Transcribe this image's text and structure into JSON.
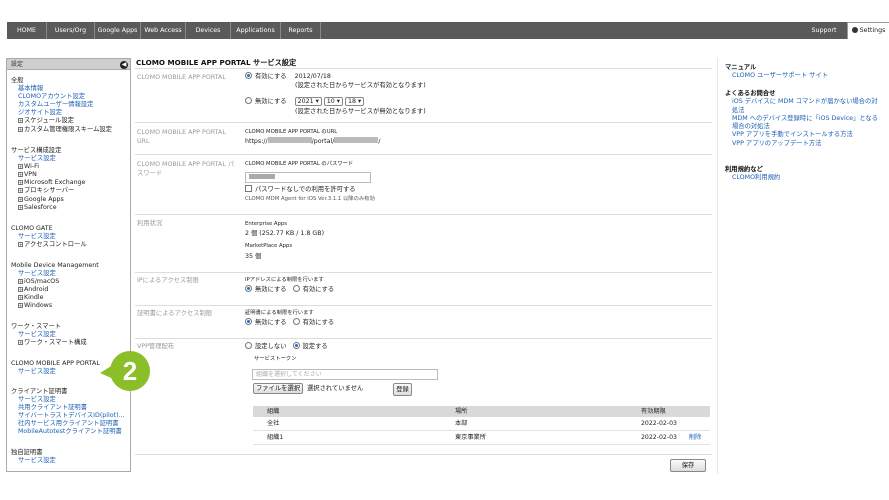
{
  "topnav": {
    "items": [
      "HOME",
      "Users/Org",
      "Google Apps",
      "Web Access",
      "Devices",
      "Applications",
      "Reports"
    ],
    "support": "Support",
    "settings": "Settings"
  },
  "sidebar": {
    "header": "設定",
    "collapse_glyph": "◀",
    "general": {
      "title": "全般",
      "links": [
        "基本情報",
        "CLOMOアカウント設定",
        "カスタムユーザー情報設定",
        "ジオサイト設定"
      ],
      "subs": [
        "スケジュール設定",
        "カスタム管理権限スキーム設定"
      ]
    },
    "service": {
      "title": "サービス構成設定",
      "links": [
        "サービス設定"
      ],
      "subs": [
        "Wi-Fi",
        "VPN",
        "Microsoft Exchange",
        "プロキシサーバー",
        "Google Apps",
        "Salesforce"
      ]
    },
    "gate": {
      "title": "CLOMO GATE",
      "links": [
        "サービス設定"
      ],
      "subs": [
        "アクセスコントロール"
      ]
    },
    "mdm": {
      "title": "Mobile Device Management",
      "links": [
        "サービス設定"
      ],
      "subs": [
        "iOS/macOS",
        "Android",
        "Kindle",
        "Windows"
      ]
    },
    "worksmart": {
      "title": "ワーク・スマート",
      "links": [
        "サービス設定"
      ],
      "subs": [
        "ワーク・スマート構成"
      ]
    },
    "portal": {
      "title": "CLOMO MOBILE APP PORTAL",
      "links": [
        "サービス設定"
      ]
    },
    "clientcert": {
      "title": "クライアント証明書",
      "links": [
        "サービス設定",
        "共用クライアント証明書",
        "サイバートラストデバイスID(pilot)...",
        "社内サービス用クライアント証明書",
        "MobileAutotestクライアント証明書"
      ]
    },
    "owncert": {
      "title": "独自証明書",
      "links": [
        "サービス設定"
      ]
    }
  },
  "badge": "2",
  "main": {
    "title": "CLOMO MOBILE APP PORTAL サービス設定",
    "portal": {
      "label": "CLOMO MOBILE APP PORTAL",
      "enable_label": "有効にする",
      "enable_date": "2012/07/18",
      "enable_note": "(設定された日からサービスが有効となります)",
      "disable_label": "無効にする",
      "year": "2021",
      "month": "10",
      "day": "18",
      "disable_note": "(設定された日からサービスが無効となります)"
    },
    "url": {
      "label": "CLOMO MOBILE APP PORTAL URL",
      "caption": "CLOMO MOBILE APP PORTAL のURL",
      "prefix": "https://",
      "mid": "/portal/",
      "suffix": "/"
    },
    "password": {
      "label": "CLOMO MOBILE APP PORTAL パスワード",
      "caption": "CLOMO MOBILE APP PORTAL のパスワード",
      "allow_label": "パスワードなしでの利用を許可する",
      "agent_note": "CLOMO MDM Agent for iOS Ver.3.1.1 以降のみ有効"
    },
    "usage": {
      "label": "利用状況",
      "enterprise_title": "Enterprise Apps",
      "enterprise_value": "2 個 (252.77 KB / 1.8 GB)",
      "marketplace_title": "MarketPlace Apps",
      "marketplace_value": "35 個"
    },
    "ip": {
      "label": "IPによるアクセス制限",
      "caption": "IPアドレスによる制限を行います",
      "off": "無効にする",
      "on": "有効にする"
    },
    "cert": {
      "label": "証明書によるアクセス制限",
      "caption": "証明書による制限を行います",
      "off": "無効にする",
      "on": "有効にする"
    },
    "vpp": {
      "label": "VPP管理配布",
      "no": "設定しない",
      "yes": "設定する",
      "token_caption": "サービストークン",
      "org_placeholder": "組織を選択してください",
      "file_button": "ファイルを選択",
      "file_status": "選択されていません",
      "register_button": "登録",
      "table": {
        "headers": [
          "組織",
          "場所",
          "有効期限"
        ],
        "rows": [
          {
            "org": "全社",
            "place": "本部",
            "expiry": "2022-02-03",
            "action": ""
          },
          {
            "org": "組織1",
            "place": "東京事業所",
            "expiry": "2022-02-03",
            "action": "削除"
          }
        ]
      }
    },
    "save_button": "保存"
  },
  "right": {
    "manual_title": "マニュアル",
    "manual_links": [
      "CLOMO ユーザーサポート サイト"
    ],
    "faq_title": "よくあるお問合せ",
    "faq_links": [
      "iOS デバイスに MDM コマンドが届かない場合の対処法",
      "MDM へのデバイス登録時に「iOS Device」となる場合の対処法",
      "VPP アプリを手動でインストールする方法",
      "VPP アプリのアップデート方法"
    ],
    "terms_title": "利用規約など",
    "terms_links": [
      "CLOMO利用規約"
    ]
  }
}
